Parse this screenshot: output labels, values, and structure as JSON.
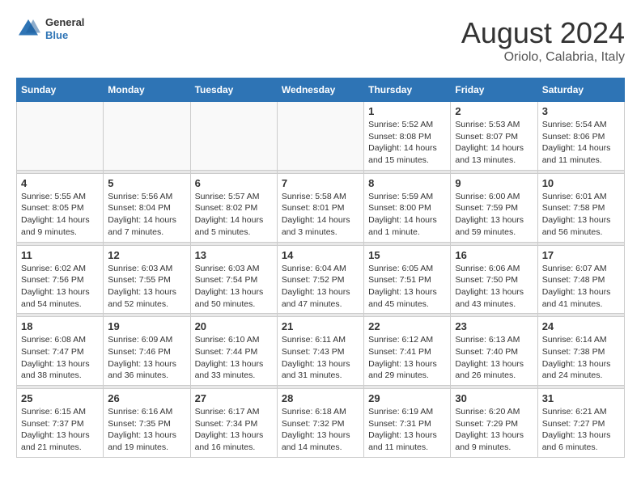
{
  "header": {
    "logo": {
      "general": "General",
      "blue": "Blue"
    },
    "title": "August 2024",
    "location": "Oriolo, Calabria, Italy"
  },
  "calendar": {
    "days_of_week": [
      "Sunday",
      "Monday",
      "Tuesday",
      "Wednesday",
      "Thursday",
      "Friday",
      "Saturday"
    ],
    "weeks": [
      [
        {
          "day": "",
          "info": ""
        },
        {
          "day": "",
          "info": ""
        },
        {
          "day": "",
          "info": ""
        },
        {
          "day": "",
          "info": ""
        },
        {
          "day": "1",
          "info": "Sunrise: 5:52 AM\nSunset: 8:08 PM\nDaylight: 14 hours and 15 minutes."
        },
        {
          "day": "2",
          "info": "Sunrise: 5:53 AM\nSunset: 8:07 PM\nDaylight: 14 hours and 13 minutes."
        },
        {
          "day": "3",
          "info": "Sunrise: 5:54 AM\nSunset: 8:06 PM\nDaylight: 14 hours and 11 minutes."
        }
      ],
      [
        {
          "day": "4",
          "info": "Sunrise: 5:55 AM\nSunset: 8:05 PM\nDaylight: 14 hours and 9 minutes."
        },
        {
          "day": "5",
          "info": "Sunrise: 5:56 AM\nSunset: 8:04 PM\nDaylight: 14 hours and 7 minutes."
        },
        {
          "day": "6",
          "info": "Sunrise: 5:57 AM\nSunset: 8:02 PM\nDaylight: 14 hours and 5 minutes."
        },
        {
          "day": "7",
          "info": "Sunrise: 5:58 AM\nSunset: 8:01 PM\nDaylight: 14 hours and 3 minutes."
        },
        {
          "day": "8",
          "info": "Sunrise: 5:59 AM\nSunset: 8:00 PM\nDaylight: 14 hours and 1 minute."
        },
        {
          "day": "9",
          "info": "Sunrise: 6:00 AM\nSunset: 7:59 PM\nDaylight: 13 hours and 59 minutes."
        },
        {
          "day": "10",
          "info": "Sunrise: 6:01 AM\nSunset: 7:58 PM\nDaylight: 13 hours and 56 minutes."
        }
      ],
      [
        {
          "day": "11",
          "info": "Sunrise: 6:02 AM\nSunset: 7:56 PM\nDaylight: 13 hours and 54 minutes."
        },
        {
          "day": "12",
          "info": "Sunrise: 6:03 AM\nSunset: 7:55 PM\nDaylight: 13 hours and 52 minutes."
        },
        {
          "day": "13",
          "info": "Sunrise: 6:03 AM\nSunset: 7:54 PM\nDaylight: 13 hours and 50 minutes."
        },
        {
          "day": "14",
          "info": "Sunrise: 6:04 AM\nSunset: 7:52 PM\nDaylight: 13 hours and 47 minutes."
        },
        {
          "day": "15",
          "info": "Sunrise: 6:05 AM\nSunset: 7:51 PM\nDaylight: 13 hours and 45 minutes."
        },
        {
          "day": "16",
          "info": "Sunrise: 6:06 AM\nSunset: 7:50 PM\nDaylight: 13 hours and 43 minutes."
        },
        {
          "day": "17",
          "info": "Sunrise: 6:07 AM\nSunset: 7:48 PM\nDaylight: 13 hours and 41 minutes."
        }
      ],
      [
        {
          "day": "18",
          "info": "Sunrise: 6:08 AM\nSunset: 7:47 PM\nDaylight: 13 hours and 38 minutes."
        },
        {
          "day": "19",
          "info": "Sunrise: 6:09 AM\nSunset: 7:46 PM\nDaylight: 13 hours and 36 minutes."
        },
        {
          "day": "20",
          "info": "Sunrise: 6:10 AM\nSunset: 7:44 PM\nDaylight: 13 hours and 33 minutes."
        },
        {
          "day": "21",
          "info": "Sunrise: 6:11 AM\nSunset: 7:43 PM\nDaylight: 13 hours and 31 minutes."
        },
        {
          "day": "22",
          "info": "Sunrise: 6:12 AM\nSunset: 7:41 PM\nDaylight: 13 hours and 29 minutes."
        },
        {
          "day": "23",
          "info": "Sunrise: 6:13 AM\nSunset: 7:40 PM\nDaylight: 13 hours and 26 minutes."
        },
        {
          "day": "24",
          "info": "Sunrise: 6:14 AM\nSunset: 7:38 PM\nDaylight: 13 hours and 24 minutes."
        }
      ],
      [
        {
          "day": "25",
          "info": "Sunrise: 6:15 AM\nSunset: 7:37 PM\nDaylight: 13 hours and 21 minutes."
        },
        {
          "day": "26",
          "info": "Sunrise: 6:16 AM\nSunset: 7:35 PM\nDaylight: 13 hours and 19 minutes."
        },
        {
          "day": "27",
          "info": "Sunrise: 6:17 AM\nSunset: 7:34 PM\nDaylight: 13 hours and 16 minutes."
        },
        {
          "day": "28",
          "info": "Sunrise: 6:18 AM\nSunset: 7:32 PM\nDaylight: 13 hours and 14 minutes."
        },
        {
          "day": "29",
          "info": "Sunrise: 6:19 AM\nSunset: 7:31 PM\nDaylight: 13 hours and 11 minutes."
        },
        {
          "day": "30",
          "info": "Sunrise: 6:20 AM\nSunset: 7:29 PM\nDaylight: 13 hours and 9 minutes."
        },
        {
          "day": "31",
          "info": "Sunrise: 6:21 AM\nSunset: 7:27 PM\nDaylight: 13 hours and 6 minutes."
        }
      ]
    ]
  }
}
